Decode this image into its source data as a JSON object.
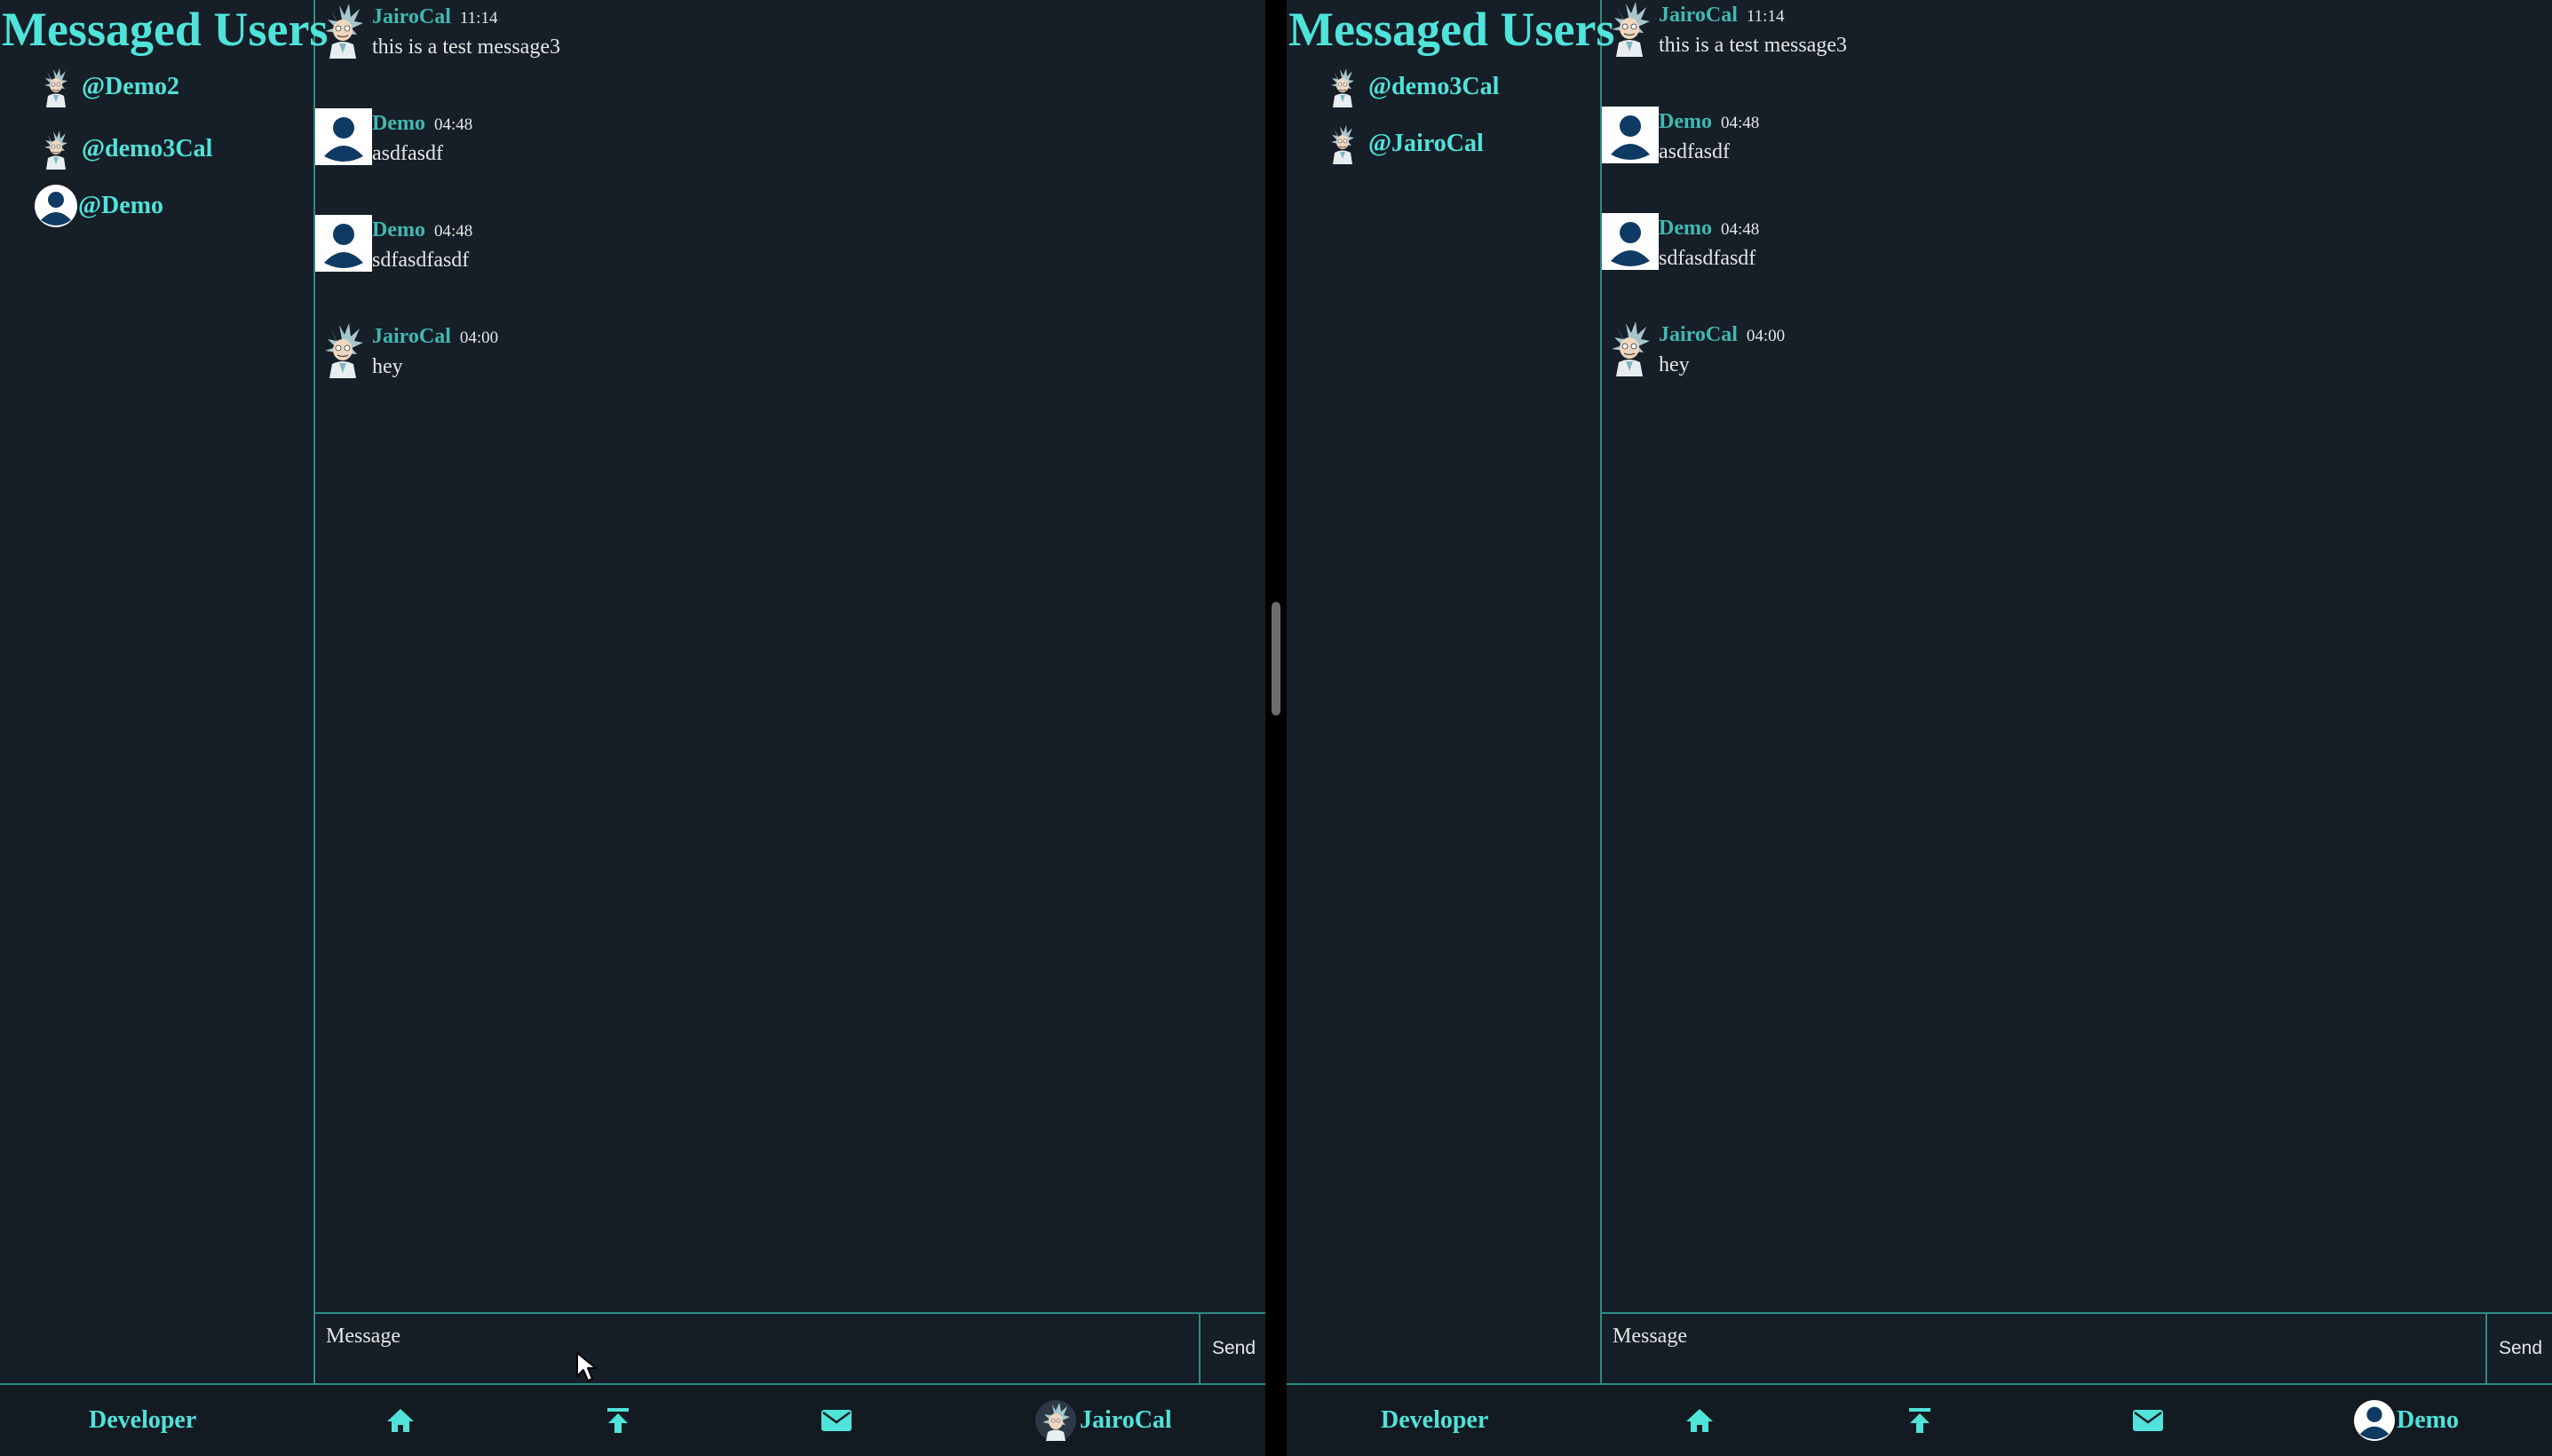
{
  "colors": {
    "accent": "#4fe3da",
    "username": "#3fb9b1",
    "background": "#161e27",
    "border": "#2e8a85",
    "text": "#e6e6e6"
  },
  "left_window": {
    "sidebar_title": "Messaged Users",
    "contacts": [
      {
        "handle": "@Demo2",
        "avatar": "rick-avatar-icon"
      },
      {
        "handle": "@demo3Cal",
        "avatar": "rick-avatar-icon"
      },
      {
        "handle": "@Demo",
        "avatar": "default-user-avatar-icon"
      }
    ],
    "messages": [
      {
        "user": "JairoCal",
        "time": "11:14",
        "text": "this is a test message3",
        "avatar": "rick-avatar-icon"
      },
      {
        "user": "Demo",
        "time": "04:48",
        "text": "asdfasdf",
        "avatar": "default-user-avatar-icon"
      },
      {
        "user": "Demo",
        "time": "04:48",
        "text": "sdfasdfasdf",
        "avatar": "default-user-avatar-icon"
      },
      {
        "user": "JairoCal",
        "time": "04:00",
        "text": "hey",
        "avatar": "rick-avatar-icon"
      }
    ],
    "composer": {
      "placeholder": "Message",
      "send_label": "Send"
    },
    "nav": {
      "brand": "Developer",
      "home_icon": "home-icon",
      "upload_icon": "upload-icon",
      "mail_icon": "mail-icon",
      "profile_name": "JairoCal",
      "profile_avatar": "rick-avatar-icon"
    }
  },
  "right_window": {
    "sidebar_title": "Messaged Users",
    "contacts": [
      {
        "handle": "@demo3Cal",
        "avatar": "rick-avatar-icon"
      },
      {
        "handle": "@JairoCal",
        "avatar": "rick-avatar-icon"
      }
    ],
    "messages": [
      {
        "user": "JairoCal",
        "time": "11:14",
        "text": "this is a test message3",
        "avatar": "rick-avatar-icon"
      },
      {
        "user": "Demo",
        "time": "04:48",
        "text": "asdfasdf",
        "avatar": "default-user-avatar-icon"
      },
      {
        "user": "Demo",
        "time": "04:48",
        "text": "sdfasdfasdf",
        "avatar": "default-user-avatar-icon"
      },
      {
        "user": "JairoCal",
        "time": "04:00",
        "text": "hey",
        "avatar": "rick-avatar-icon"
      }
    ],
    "composer": {
      "placeholder": "Message",
      "send_label": "Send"
    },
    "nav": {
      "brand": "Developer",
      "home_icon": "home-icon",
      "upload_icon": "upload-icon",
      "mail_icon": "mail-icon",
      "profile_name": "Demo",
      "profile_avatar": "default-user-avatar-icon"
    }
  }
}
